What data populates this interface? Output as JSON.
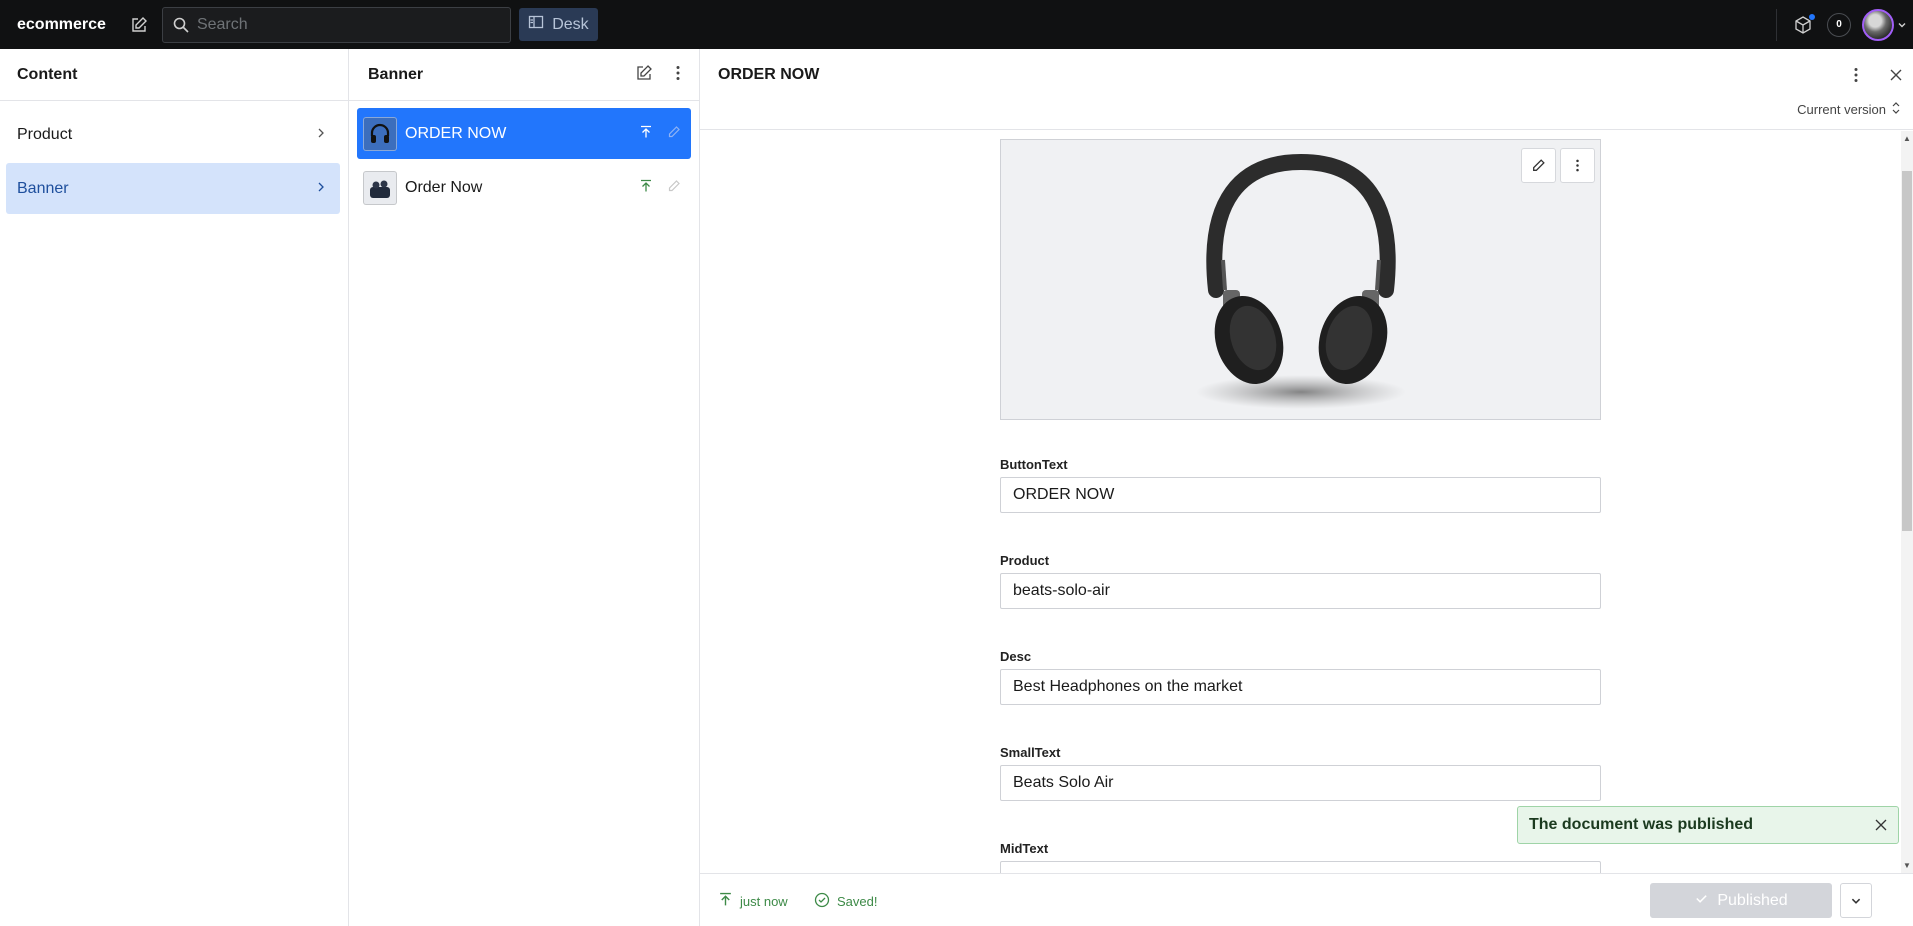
{
  "app": {
    "brand": "ecommerce",
    "search_placeholder": "Search",
    "desk_label": "Desk",
    "notification_count": "0"
  },
  "pane_content": {
    "title": "Content",
    "items": [
      {
        "label": "Product"
      },
      {
        "label": "Banner"
      }
    ]
  },
  "pane_banner": {
    "title": "Banner",
    "documents": [
      {
        "title": "ORDER NOW"
      },
      {
        "title": "Order Now"
      }
    ]
  },
  "document": {
    "title": "ORDER NOW",
    "version": "Current version",
    "fields": {
      "button_text": {
        "label": "ButtonText",
        "value": "ORDER NOW"
      },
      "product": {
        "label": "Product",
        "value": "beats-solo-air"
      },
      "desc": {
        "label": "Desc",
        "value": "Best Headphones on the market"
      },
      "small_text": {
        "label": "SmallText",
        "value": "Beats Solo Air"
      },
      "mid_text": {
        "label": "MidText",
        "value": ""
      }
    }
  },
  "toast": {
    "message": "The document was published"
  },
  "footer": {
    "published_time": "just now",
    "saved_status": "Saved!",
    "publish_button": "Published"
  },
  "colors": {
    "topbar": "#101112",
    "accent": "#2276fc",
    "selected_nav": "#d4e3fb",
    "success": "#3d8a47"
  }
}
